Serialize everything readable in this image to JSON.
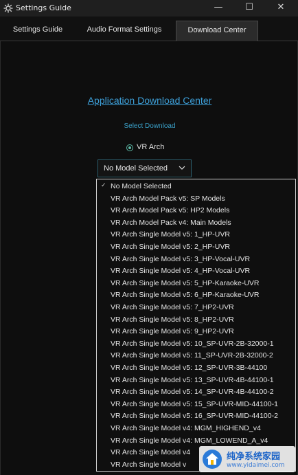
{
  "window": {
    "title": "Settings Guide",
    "controls": {
      "minimize": "—",
      "maximize": "☐",
      "close": "✕"
    }
  },
  "tabs": [
    {
      "label": "Settings Guide",
      "active": false
    },
    {
      "label": "Audio Format Settings",
      "active": false
    },
    {
      "label": "Download Center",
      "active": true
    }
  ],
  "main": {
    "heading": "Application Download Center",
    "select_label": "Select Download",
    "radio_label": "VR Arch",
    "combo_value": "No Model Selected"
  },
  "dropdown": {
    "items": [
      "No Model Selected",
      "VR Arch Model Pack v5: SP Models",
      "VR Arch Model Pack v5: HP2 Models",
      "VR Arch Model Pack v4: Main Models",
      "VR Arch Single Model v5: 1_HP-UVR",
      "VR Arch Single Model v5: 2_HP-UVR",
      "VR Arch Single Model v5: 3_HP-Vocal-UVR",
      "VR Arch Single Model v5: 4_HP-Vocal-UVR",
      "VR Arch Single Model v5: 5_HP-Karaoke-UVR",
      "VR Arch Single Model v5: 6_HP-Karaoke-UVR",
      "VR Arch Single Model v5: 7_HP2-UVR",
      "VR Arch Single Model v5: 8_HP2-UVR",
      "VR Arch Single Model v5: 9_HP2-UVR",
      "VR Arch Single Model v5: 10_SP-UVR-2B-32000-1",
      "VR Arch Single Model v5: 11_SP-UVR-2B-32000-2",
      "VR Arch Single Model v5: 12_SP-UVR-3B-44100",
      "VR Arch Single Model v5: 13_SP-UVR-4B-44100-1",
      "VR Arch Single Model v5: 14_SP-UVR-4B-44100-2",
      "VR Arch Single Model v5: 15_SP-UVR-MID-44100-1",
      "VR Arch Single Model v5: 16_SP-UVR-MID-44100-2",
      "VR Arch Single Model v4: MGM_HIGHEND_v4",
      "VR Arch Single Model v4: MGM_LOWEND_A_v4",
      "VR Arch Single Model v4",
      "VR Arch Single Model v"
    ],
    "selected_index": 0
  },
  "watermark": {
    "line1": "纯净系统家园",
    "line2": "www.yidaimei.com"
  },
  "colors": {
    "accent": "#3d9fd8",
    "radio": "#5bb8a5",
    "background": "#0e0e0e"
  }
}
